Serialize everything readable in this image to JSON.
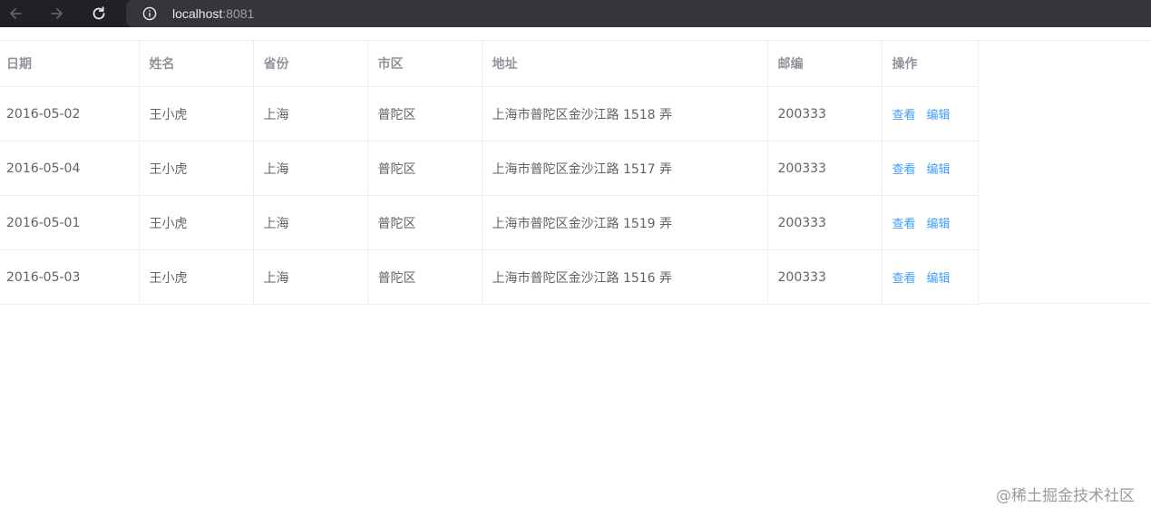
{
  "browser": {
    "url_host": "localhost",
    "url_port": ":8081",
    "icons": [
      "back-arrow-icon",
      "forward-arrow-icon",
      "reload-icon",
      "info-icon"
    ]
  },
  "table": {
    "headers": {
      "date": "日期",
      "name": "姓名",
      "province": "省份",
      "city": "市区",
      "address": "地址",
      "zip": "邮编",
      "actions": "操作"
    },
    "rows": [
      {
        "date": "2016-05-02",
        "name": "王小虎",
        "province": "上海",
        "city": "普陀区",
        "address": "上海市普陀区金沙江路 1518 弄",
        "zip": "200333",
        "view": "查看",
        "edit": "编辑"
      },
      {
        "date": "2016-05-04",
        "name": "王小虎",
        "province": "上海",
        "city": "普陀区",
        "address": "上海市普陀区金沙江路 1517 弄",
        "zip": "200333",
        "view": "查看",
        "edit": "编辑"
      },
      {
        "date": "2016-05-01",
        "name": "王小虎",
        "province": "上海",
        "city": "普陀区",
        "address": "上海市普陀区金沙江路 1519 弄",
        "zip": "200333",
        "view": "查看",
        "edit": "编辑"
      },
      {
        "date": "2016-05-03",
        "name": "王小虎",
        "province": "上海",
        "city": "普陀区",
        "address": "上海市普陀区金沙江路 1516 弄",
        "zip": "200333",
        "view": "查看",
        "edit": "编辑"
      }
    ]
  },
  "watermark": "@稀土掘金技术社区",
  "colors": {
    "link": "#409eff",
    "text": "#606266",
    "header_text": "#909399",
    "border": "#ebeef5",
    "browser_chrome": "#202124"
  }
}
